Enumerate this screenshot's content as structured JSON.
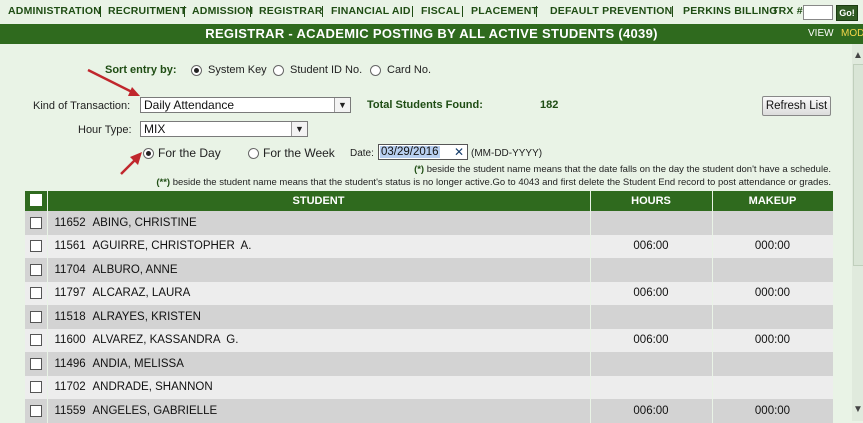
{
  "nav": {
    "items": [
      "ADMINISTRATION",
      "RECRUITMENT",
      "ADMISSION",
      "REGISTRAR",
      "FINANCIAL AID",
      "FISCAL",
      "PLACEMENT",
      "DEFAULT PREVENTION",
      "PERKINS BILLING"
    ],
    "trx_label": "TRX #:",
    "go_label": "Go!"
  },
  "titlebar": {
    "title": "REGISTRAR - ACADEMIC POSTING BY ALL ACTIVE STUDENTS (4039)",
    "view": "VIEW",
    "mod": "MOD"
  },
  "sort": {
    "label": "Sort entry by:",
    "options": [
      "System Key",
      "Student ID No.",
      "Card No."
    ],
    "selected": "System Key"
  },
  "transaction": {
    "label": "Kind of Transaction:",
    "value": "Daily Attendance",
    "total_label": "Total Students Found:",
    "total_value": "182",
    "refresh_label": "Refresh List"
  },
  "hour_type": {
    "label": "Hour Type:",
    "value": "MIX"
  },
  "period": {
    "options": [
      "For the Day",
      "For the Week"
    ],
    "selected": "For the Day",
    "date_label": "Date:",
    "date_value": "03/29/2016",
    "date_format": "(MM-DD-YYYY)"
  },
  "notes": {
    "n1_marker": "(*)",
    "n1_text": " beside the student name means that the date falls on the day the student don't have a schedule.",
    "n2_marker": "(**)",
    "n2_text": " beside the student name means that the student's status is no longer active.Go to 4043 and first delete the Student End record to post attendance or grades."
  },
  "table": {
    "headers": [
      "STUDENT",
      "HOURS",
      "MAKEUP"
    ],
    "rows": [
      {
        "id": "11652",
        "name": "ABING, CHRISTINE",
        "hours": "",
        "makeup": ""
      },
      {
        "id": "11561",
        "name": "AGUIRRE, CHRISTOPHER  A.",
        "hours": "006:00",
        "makeup": "000:00"
      },
      {
        "id": "11704",
        "name": "ALBURO, ANNE",
        "hours": "",
        "makeup": ""
      },
      {
        "id": "11797",
        "name": "ALCARAZ, LAURA",
        "hours": "006:00",
        "makeup": "000:00"
      },
      {
        "id": "11518",
        "name": "ALRAYES, KRISTEN",
        "hours": "",
        "makeup": ""
      },
      {
        "id": "11600",
        "name": "ALVAREZ, KASSANDRA  G.",
        "hours": "006:00",
        "makeup": "000:00"
      },
      {
        "id": "11496",
        "name": "ANDIA, MELISSA",
        "hours": "",
        "makeup": ""
      },
      {
        "id": "11702",
        "name": "ANDRADE, SHANNON",
        "hours": "",
        "makeup": ""
      },
      {
        "id": "11559",
        "name": "ANGELES, GABRIELLE",
        "hours": "006:00",
        "makeup": "000:00"
      }
    ]
  },
  "colors": {
    "accent_dark_green": "#2f6a1e",
    "background": "#e9f3e6",
    "annotation_red": "#c0272d"
  }
}
